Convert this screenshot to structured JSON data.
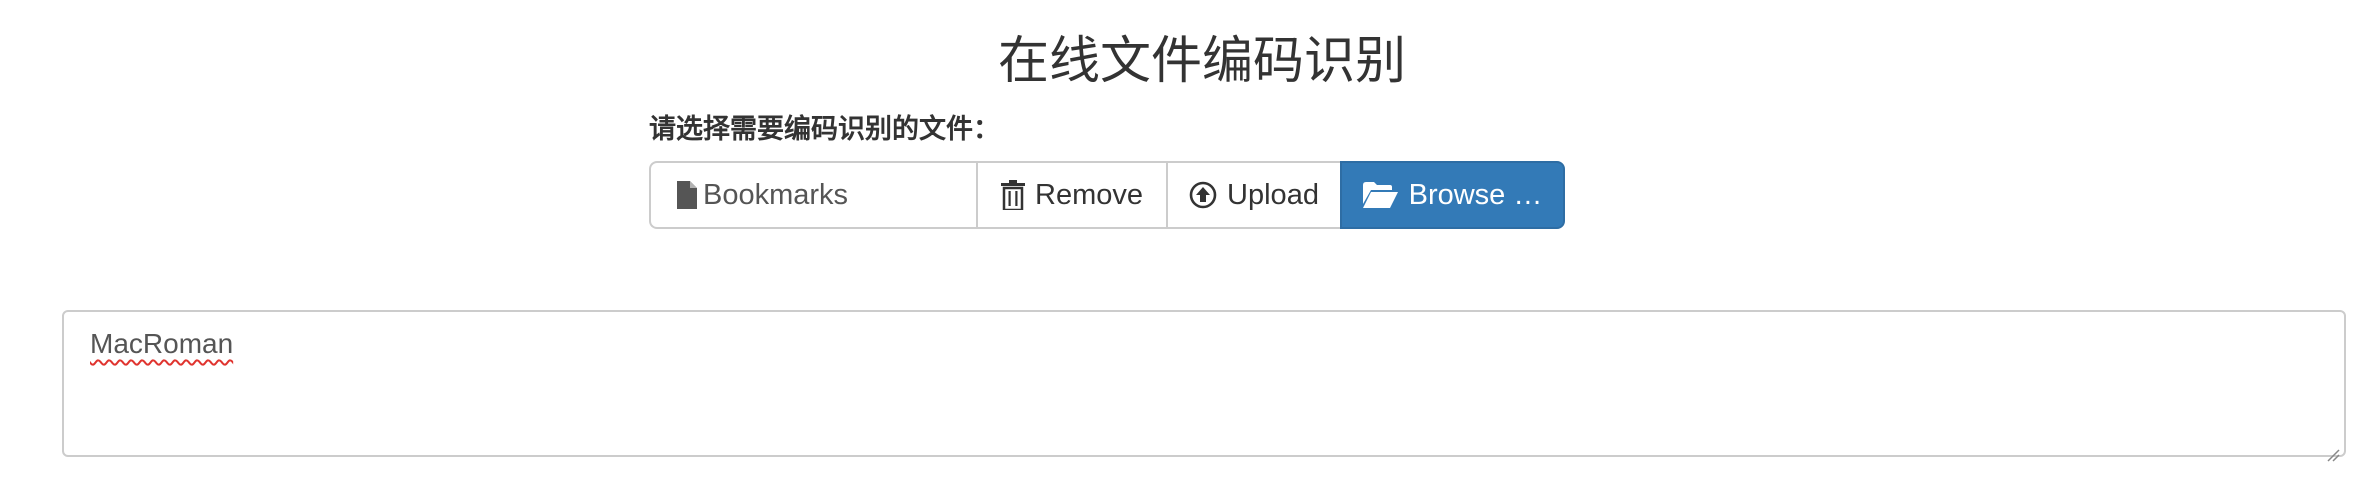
{
  "page": {
    "title": "在线文件编码识别",
    "field_label": "请选择需要编码识别的文件："
  },
  "file_input": {
    "caption": "Bookmarks",
    "caption_icon": "file-icon",
    "remove_label": "Remove",
    "remove_icon": "trash-icon",
    "upload_label": "Upload",
    "upload_icon": "upload-circle-icon",
    "browse_label": "Browse …",
    "browse_icon": "folder-open-icon"
  },
  "result": {
    "value": "MacRoman"
  },
  "colors": {
    "primary": "#337ab7",
    "border": "#cccccc",
    "text": "#333333",
    "spellcheck_underline": "#e0342f"
  }
}
